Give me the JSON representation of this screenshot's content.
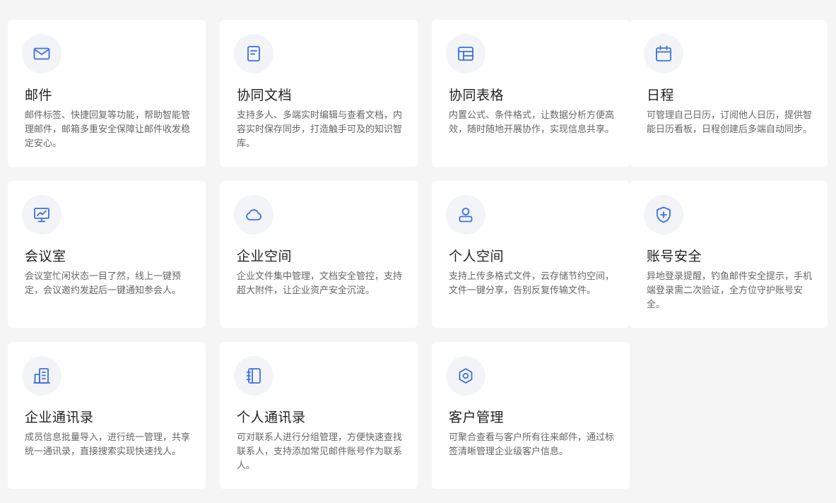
{
  "features": [
    {
      "title": "邮件",
      "desc": "邮件标签、快捷回复等功能，帮助智能管理邮件，邮箱多重安全保障让邮件收发稳定安心。",
      "icon": "mail-icon"
    },
    {
      "title": "协同文档",
      "desc": "支持多人、多端实时编辑与查看文档，内容实时保存同步，打造触手可及的知识智库。",
      "icon": "document-icon"
    },
    {
      "title": "协同表格",
      "desc": "内置公式、条件格式，让数据分析方便高效，随时随地开展协作，实现信息共享。",
      "icon": "table-icon"
    },
    {
      "title": "日程",
      "desc": "可管理自己日历，订阅他人日历，提供智能日历看板，日程创建后多端自动同步。",
      "icon": "calendar-icon"
    },
    {
      "title": "会议室",
      "desc": "会议室忙闲状态一目了然，线上一键预定，会议邀约发起后一键通知参会人。",
      "icon": "monitor-icon"
    },
    {
      "title": "企业空间",
      "desc": "企业文件集中管理，文档安全管控，支持超大附件，让企业资产安全沉淀。",
      "icon": "cloud-icon"
    },
    {
      "title": "个人空间",
      "desc": "支持上传多格式文件，云存储节约空间，文件一键分享，告别反复传输文件。",
      "icon": "user-icon"
    },
    {
      "title": "账号安全",
      "desc": "异地登录提醒，钓鱼邮件安全提示，手机端登录需二次验证，全方位守护账号安全。",
      "icon": "shield-icon"
    },
    {
      "title": "企业通讯录",
      "desc": "成员信息批量导入，进行统一管理，共享统一通讯录，直接搜索实现快速找人。",
      "icon": "building-icon"
    },
    {
      "title": "个人通讯录",
      "desc": "可对联系人进行分组管理，方便快速查找联系人，支持添加常见邮件账号作为联系人。",
      "icon": "contact-book-icon"
    },
    {
      "title": "客户管理",
      "desc": "可聚合查看与客户所有往来邮件，通过标签清晰管理企业级客户信息。",
      "icon": "hexagon-icon"
    }
  ],
  "colors": {
    "accent": "#3b6fe0",
    "background": "#f5f5f5",
    "card": "#ffffff",
    "title": "#222222",
    "desc": "#666666"
  }
}
